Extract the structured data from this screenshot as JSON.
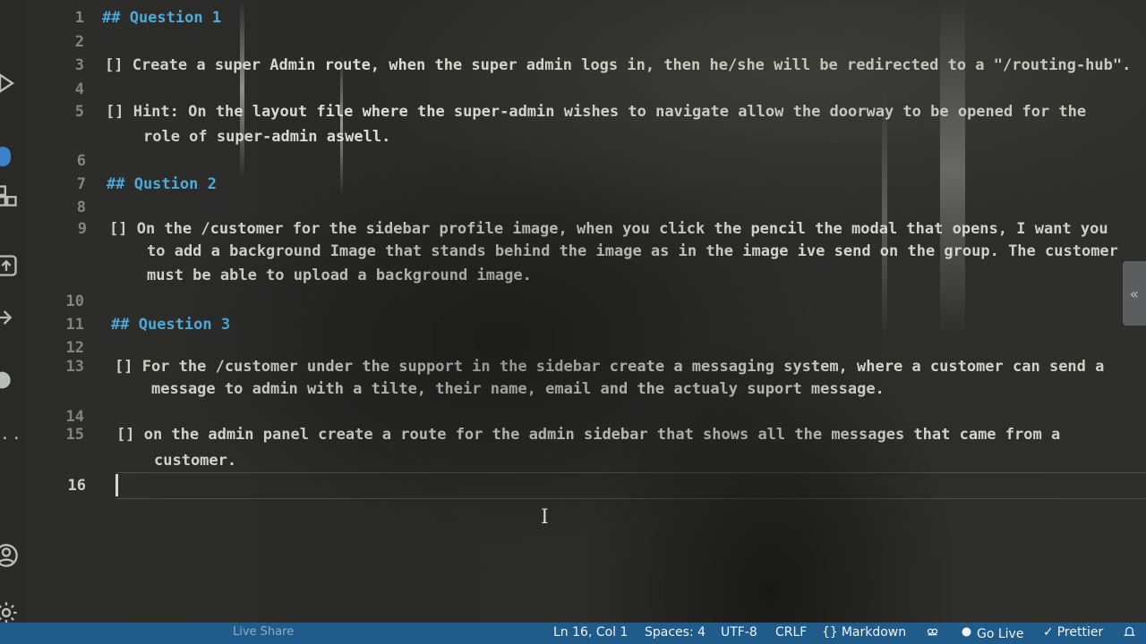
{
  "editor": {
    "lines": [
      {
        "num": "1",
        "text": "## Question 1",
        "kind": "heading"
      },
      {
        "num": "2",
        "text": "",
        "kind": "text"
      },
      {
        "num": "3",
        "text": "[] Create a super Admin route, when the super admin logs in, then he/she will be redirected to a \"/routing-hub\".",
        "kind": "text"
      },
      {
        "num": "4",
        "text": "",
        "kind": "text"
      },
      {
        "num": "5",
        "text": "[] Hint: On the layout file where the super-admin wishes to navigate allow the doorway to be opened for the",
        "kind": "text"
      },
      {
        "num": "",
        "text": "role of super-admin aswell.",
        "kind": "text"
      },
      {
        "num": "6",
        "text": "",
        "kind": "text"
      },
      {
        "num": "7",
        "text": "## Qustion 2",
        "kind": "heading"
      },
      {
        "num": "8",
        "text": "",
        "kind": "text"
      },
      {
        "num": "9",
        "text": "[] On the /customer for the sidebar profile image, when you click the pencil the modal that opens, I want you",
        "kind": "text"
      },
      {
        "num": "",
        "text": "to add a background Image that stands behind the image as in the image ive send on the group. The customer",
        "kind": "text"
      },
      {
        "num": "",
        "text": "must be able to upload a background image.",
        "kind": "text"
      },
      {
        "num": "10",
        "text": "",
        "kind": "text"
      },
      {
        "num": "11",
        "text": "## Question 3",
        "kind": "heading"
      },
      {
        "num": "12",
        "text": "",
        "kind": "text"
      },
      {
        "num": "13",
        "text": "[] For the /customer under the support in the sidebar create a messaging system, where a customer can send a",
        "kind": "text"
      },
      {
        "num": "",
        "text": "message to admin with a tilte, their name, email and the actualy suport message.",
        "kind": "text"
      },
      {
        "num": "14",
        "text": "",
        "kind": "text"
      },
      {
        "num": "15",
        "text": "[] on the admin panel create a route for the admin sidebar that shows all the messages that came from a",
        "kind": "text"
      },
      {
        "num": "",
        "text": "customer.",
        "kind": "text"
      },
      {
        "num": "16",
        "text": "",
        "kind": "text"
      }
    ]
  },
  "status_bar": {
    "dim_left": "Live Share",
    "position": "Ln 16, Col 1",
    "spaces": "Spaces: 4",
    "encoding": "UTF-8",
    "eol": "CRLF",
    "language": "Markdown",
    "go_live": "Go Live",
    "prettier": "Prettier",
    "icons": [
      "braces-icon",
      "copilot-icon",
      "broadcast-icon",
      "check-icon",
      "bell-icon"
    ]
  },
  "activity_bar": {
    "icons": [
      "run-debug-icon",
      "extensions-icon",
      "remote-icon",
      "source-control-icon",
      "more-icon",
      "account-icon",
      "settings-gear-icon"
    ]
  },
  "colors": {
    "heading": "#4fb3e6",
    "status_bar": "#1f5c8c",
    "badge": "#3b8ee0"
  }
}
